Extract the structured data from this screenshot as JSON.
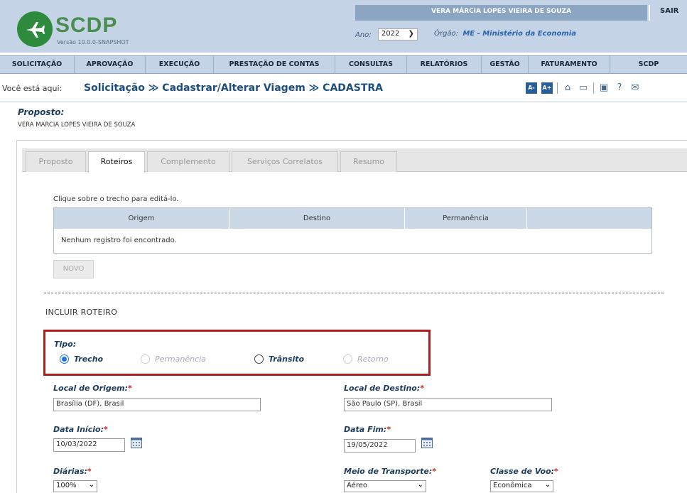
{
  "header": {
    "app_name": "SCDP",
    "version": "Versão 10.0.0-SNAPSHOT",
    "user_name": "VERA MÁRCIA LOPES VIEIRA DE SOUZA",
    "logout_label": "SAIR",
    "ano_label": "Ano:",
    "ano_value": "2022",
    "orgao_label": "Órgão:",
    "orgao_value": "ME - Ministério da Economia"
  },
  "menu": {
    "items": [
      "SOLICITAÇÃO",
      "APROVAÇÃO",
      "EXECUÇÃO",
      "PRESTAÇÃO DE CONTAS",
      "CONSULTAS",
      "RELATÓRIOS",
      "GESTÃO",
      "FATURAMENTO",
      "SCDP"
    ]
  },
  "breadcrumb": {
    "prefix": "Você está aqui:",
    "path": "Solicitação ≫ Cadastrar/Alterar Viagem ≫ CADASTRA",
    "font_smaller": "A-",
    "font_larger": "A+"
  },
  "proposto": {
    "label": "Proposto:",
    "name": "VERA MARCIA LOPES VIEIRA DE SOUZA"
  },
  "tabs": [
    "Proposto",
    "Roteiros",
    "Complemento",
    "Serviços Correlatos",
    "Resumo"
  ],
  "roteiros": {
    "hint": "Clique sobre o trecho para editá-lo.",
    "columns": [
      "Origem",
      "Destino",
      "Permanência",
      ""
    ],
    "empty_message": "Nenhum registro foi encontrado.",
    "novo_label": "NOVO"
  },
  "form": {
    "section_title": "INCLUIR ROTEIRO",
    "tipo_label": "Tipo:",
    "tipo_options": [
      "Trecho",
      "Permanência",
      "Trânsito",
      "Retorno"
    ],
    "tipo_selected": "Trecho",
    "origem_label": "Local de Origem:",
    "origem_value": "Brasília (DF), Brasil",
    "destino_label": "Local de Destino:",
    "destino_value": "São Paulo (SP), Brasil",
    "data_inicio_label": "Data Início:",
    "data_inicio_value": "10/03/2022",
    "data_fim_label": "Data Fim:",
    "data_fim_value": "19/05/2022",
    "diarias_label": "Diárias:",
    "diarias_value": "100%",
    "meio_label": "Meio de Transporte:",
    "meio_value": "Aéreo",
    "classe_label": "Classe de Voo:",
    "classe_value": "Econômica",
    "required_mark": "*"
  },
  "colors": {
    "header_bg": "#c4d4e6",
    "user_bar": "#8ba5c2",
    "brand_green": "#2e8b3d",
    "link_blue": "#1c4d7d",
    "highlight_red": "#b41c1c"
  }
}
